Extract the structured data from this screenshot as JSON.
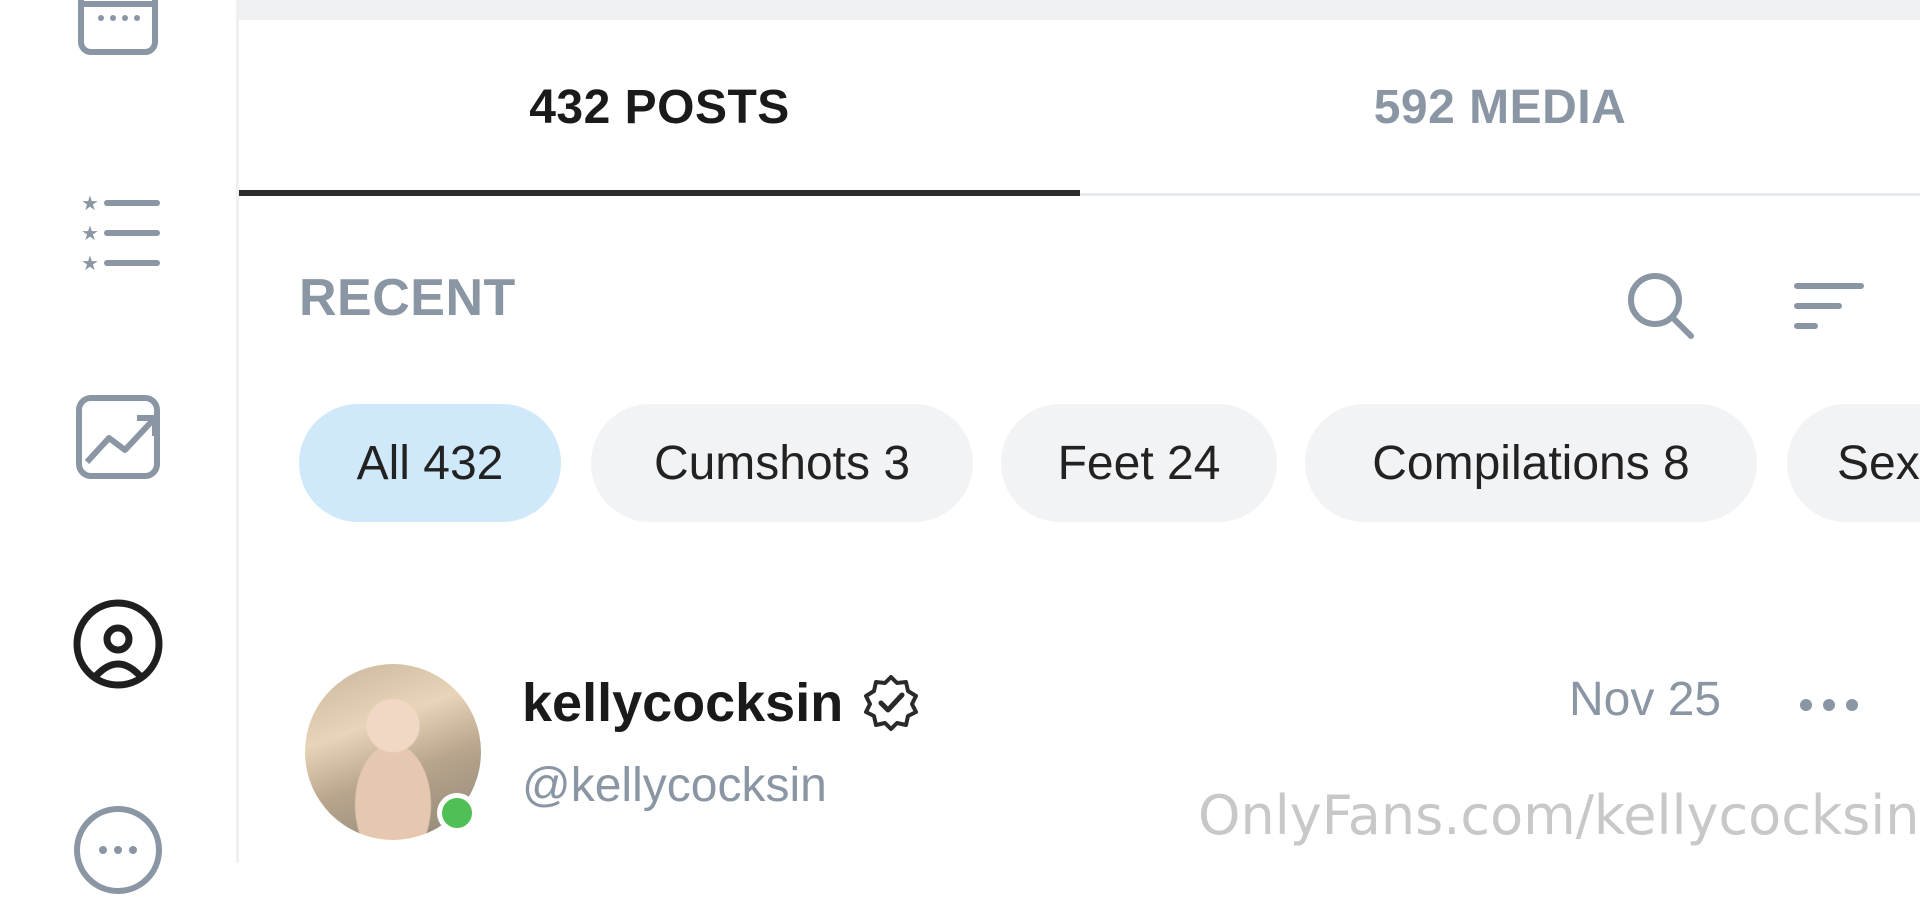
{
  "tabs": {
    "posts_label": "432 POSTS",
    "media_label": "592 MEDIA"
  },
  "filter": {
    "section_title": "RECENT",
    "chips": [
      {
        "label": "All 432",
        "active": true
      },
      {
        "label": "Cumshots 3",
        "active": false
      },
      {
        "label": "Feet 24",
        "active": false
      },
      {
        "label": "Compilations 8",
        "active": false
      },
      {
        "label": "Sex",
        "active": false
      }
    ]
  },
  "post": {
    "display_name": "kellycocksin",
    "username": "@kellycocksin",
    "date": "Nov 25",
    "watermark": "OnlyFans.com/kellycocksin",
    "online": true
  },
  "icons": {
    "rail": [
      "calendar-icon",
      "star-list-icon",
      "chart-image-icon",
      "profile-icon",
      "chat-icon"
    ],
    "search": "search-icon",
    "sort": "sort-icon",
    "verified": "verified-badge-icon",
    "more": "more-dots-icon"
  },
  "colors": {
    "active_chip": "#cfe9fb",
    "muted_text": "#8a96a3",
    "online": "#4fbf56"
  }
}
